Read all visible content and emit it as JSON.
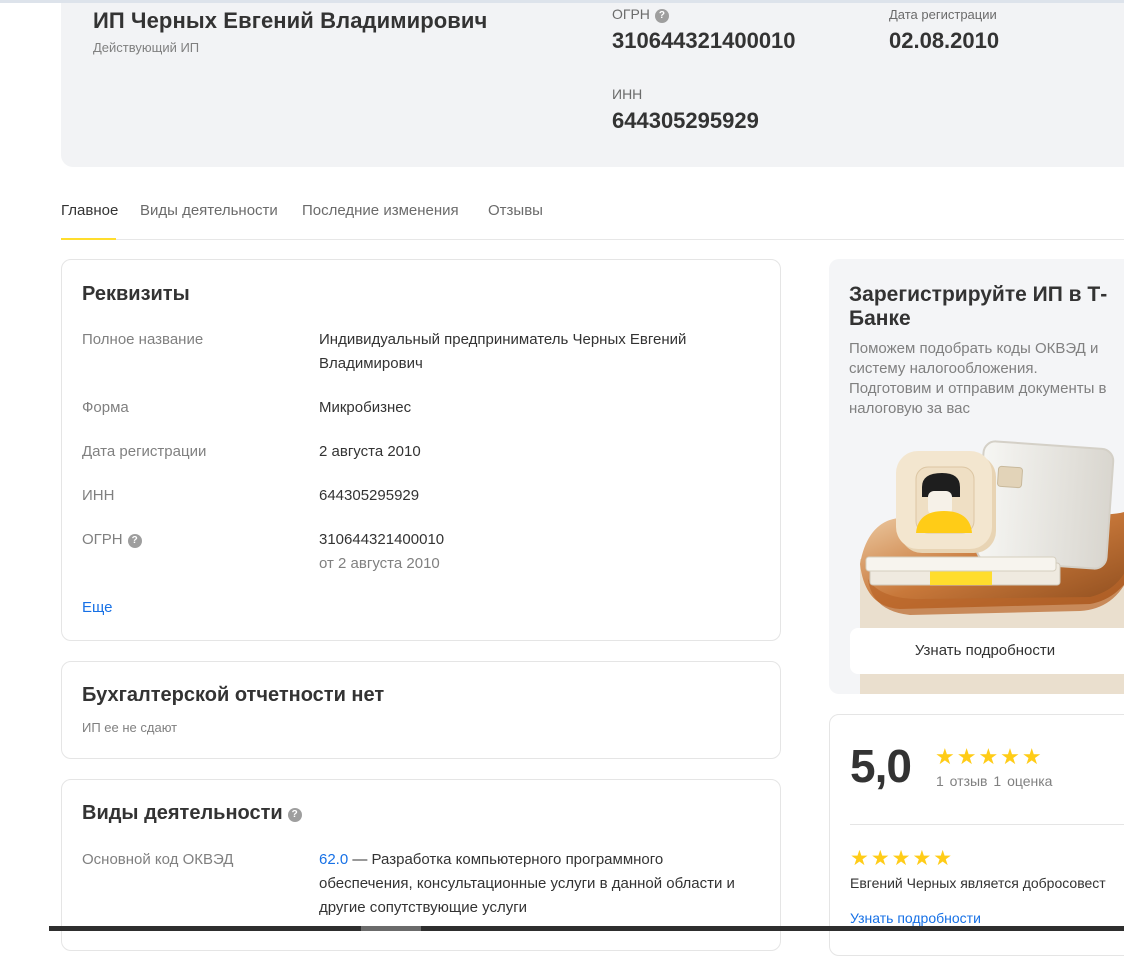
{
  "header": {
    "name": "ИП Черных Евгений Владимирович",
    "status": "Действующий ИП",
    "ogrn_label": "ОГРН",
    "ogrn_value": "310644321400010",
    "regdate_label": "Дата регистрации",
    "regdate_value": "02.08.2010",
    "inn_label": "ИНН",
    "inn_value": "644305295929"
  },
  "tabs": [
    "Главное",
    "Виды деятельности",
    "Последние изменения",
    "Отзывы"
  ],
  "requisites": {
    "title": "Реквизиты",
    "rows": [
      {
        "label": "Полное название",
        "value": "Индивидуальный предприниматель Черных Евгений Владимирович"
      },
      {
        "label": "Форма",
        "value": "Микробизнес"
      },
      {
        "label": "Дата регистрации",
        "value": "2 августа 2010"
      },
      {
        "label": "ИНН",
        "value": "644305295929"
      },
      {
        "label": "ОГРН",
        "value": "310644321400010",
        "subvalue": "от 2 августа 2010"
      }
    ],
    "more_link": "Еще"
  },
  "accounting": {
    "title": "Бухгалтерской отчетности нет",
    "subtitle": "ИП ее не сдают"
  },
  "activities": {
    "title": "Виды деятельности",
    "main_label": "Основной код ОКВЭД",
    "code": "62.0",
    "description": " — Разработка компьютерного программного обеспечения, консультационные услуги в данной области и другие сопутствующие услуги"
  },
  "promo": {
    "title": "Зарегистрируйте ИП в Т-Банке",
    "text": "Поможем подобрать коды ОКВЭД и систему налогообложения. Подготовим и отправим документы в налоговую за вас",
    "button": "Узнать подробности"
  },
  "rating": {
    "score": "5,0",
    "stars": "★★★★★",
    "reviews_count": "1 отзыв",
    "ratings_count": "1 оценка",
    "review_stars": "★★★★★",
    "review_text": "Евгений Черных является добросовест",
    "link": "Узнать подробности"
  },
  "colors": {
    "accent_yellow": "#ffdd2d",
    "link_blue": "#1771e6",
    "star_yellow": "#ffcc17",
    "hero_bg": "#f2f3f5"
  }
}
